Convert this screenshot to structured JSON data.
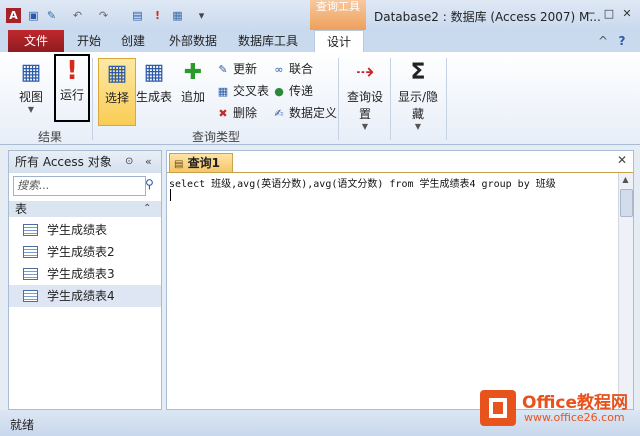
{
  "window": {
    "title": "Database2 : 数据库 (Access 2007) M...",
    "context_tab_group": "查询工具",
    "controls": {
      "minimize": "─",
      "restore": "□",
      "close": "✕"
    }
  },
  "quick_access": [
    "access-logo-icon",
    "save-icon",
    "edit-icon",
    "undo-icon",
    "redo-icon",
    "view-icon",
    "run-icon",
    "table-icon",
    "customize-icon"
  ],
  "tabs": [
    "文件",
    "开始",
    "创建",
    "外部数据",
    "数据库工具",
    "设计"
  ],
  "ribbon": {
    "help_glyph": "?",
    "collapse_glyph": "^",
    "groups": {
      "results": {
        "label": "结果",
        "view": "视图",
        "run": "运行"
      },
      "query_type": {
        "label": "查询类型",
        "select": "选择",
        "make_table": "生成表",
        "append": "追加",
        "update": "更新",
        "crosstab": "交叉表",
        "delete": "删除",
        "union": "联合",
        "pass_through": "传递",
        "data_definition": "数据定义"
      },
      "query_setup": {
        "label": "查询设置"
      },
      "show_hide": {
        "label": "显示/隐藏"
      }
    }
  },
  "nav_pane": {
    "title": "所有 Access 对象",
    "search_placeholder": "搜索...",
    "group": "表",
    "items": [
      "学生成绩表",
      "学生成绩表2",
      "学生成绩表3",
      "学生成绩表4"
    ],
    "selected_index": 3
  },
  "document": {
    "tab_label": "查询1",
    "sql": "select 班级,avg(英语分数),avg(语文分数) from 学生成绩表4 group by 班级"
  },
  "status_bar": {
    "text": "就绪"
  },
  "watermark": {
    "brand": "Office教程网",
    "url": "www.office26.com"
  },
  "colors": {
    "file_tab": "#a52228",
    "context_tab": "#eea05a",
    "selected_button": "#fbd96a",
    "run_highlight_border": "#000000"
  }
}
